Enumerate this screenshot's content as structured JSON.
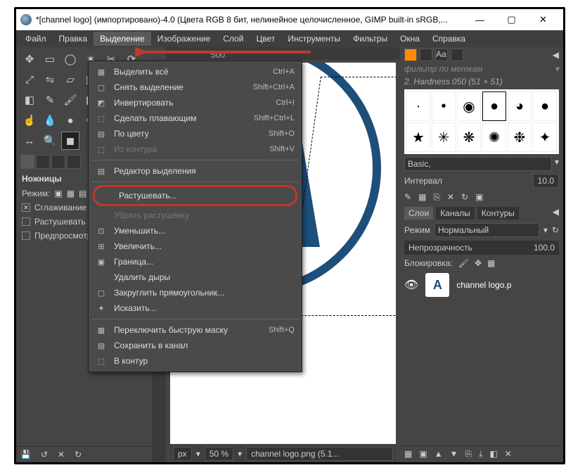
{
  "window": {
    "title": "*[channel logo] (импортировано)-4.0 (Цвета RGB 8 бит, нелинейное целочисленное, GIMP built-in sRGB,..."
  },
  "menubar": [
    "Файл",
    "Правка",
    "Выделение",
    "Изображение",
    "Слой",
    "Цвет",
    "Инструменты",
    "Фильтры",
    "Окна",
    "Справка"
  ],
  "dropdown": {
    "items": [
      {
        "icon": "▦",
        "label": "Выделить всё",
        "accel": "Ctrl+A"
      },
      {
        "icon": "▢",
        "label": "Снять выделение",
        "accel": "Shift+Ctrl+A"
      },
      {
        "icon": "◩",
        "label": "Инвертировать",
        "accel": "Ctrl+I"
      },
      {
        "icon": "⬚",
        "label": "Сделать плавающим",
        "accel": "Shift+Ctrl+L"
      },
      {
        "icon": "▤",
        "label": "По цвету",
        "accel": "Shift+O"
      },
      {
        "icon": "⬚",
        "label": "Из контура",
        "accel": "Shift+V",
        "disabled": true
      },
      {
        "sep": true
      },
      {
        "icon": "▤",
        "label": "Редактор выделения"
      },
      {
        "sep": true
      },
      {
        "icon": "",
        "label": "Растушевать...",
        "highlighted": true
      },
      {
        "icon": "",
        "label": "Убрать растушёвку",
        "disabled": true
      },
      {
        "icon": "⊡",
        "label": "Уменьшить..."
      },
      {
        "icon": "⊞",
        "label": "Увеличить..."
      },
      {
        "icon": "▣",
        "label": "Граница..."
      },
      {
        "icon": "",
        "label": "Удалить дыры"
      },
      {
        "icon": "▢",
        "label": "Закруглить прямоугольник..."
      },
      {
        "icon": "✦",
        "label": "Исказить..."
      },
      {
        "sep": true
      },
      {
        "icon": "▦",
        "label": "Переключить быструю маску",
        "accel": "Shift+Q"
      },
      {
        "icon": "▤",
        "label": "Сохранить в канал"
      },
      {
        "icon": "⬚",
        "label": "В контур"
      }
    ]
  },
  "tool_options": {
    "title": "Ножницы",
    "mode_label": "Режим:",
    "antialias": "Сглаживание",
    "feather": "Растушевать кр",
    "preview": "Предпросмотр"
  },
  "ruler_marks": [
    "",
    "500"
  ],
  "status": {
    "unit": "px",
    "zoom": "50 %",
    "file": "channel logo.png (5.1..."
  },
  "brushes": {
    "filter_placeholder": "фильтр по меткам",
    "current": "2. Hardness 050 (51 × 51)",
    "preset": "Basic,",
    "interval_label": "Интервал",
    "interval_value": "10.0"
  },
  "layers": {
    "tabs": [
      "Слои",
      "Каналы",
      "Контуры"
    ],
    "mode_label": "Режим",
    "mode_value": "Нормальный",
    "opacity_label": "Непрозрачность",
    "opacity_value": "100.0",
    "lock_label": "Блокировка:",
    "layer_name": "channel logo.p"
  }
}
